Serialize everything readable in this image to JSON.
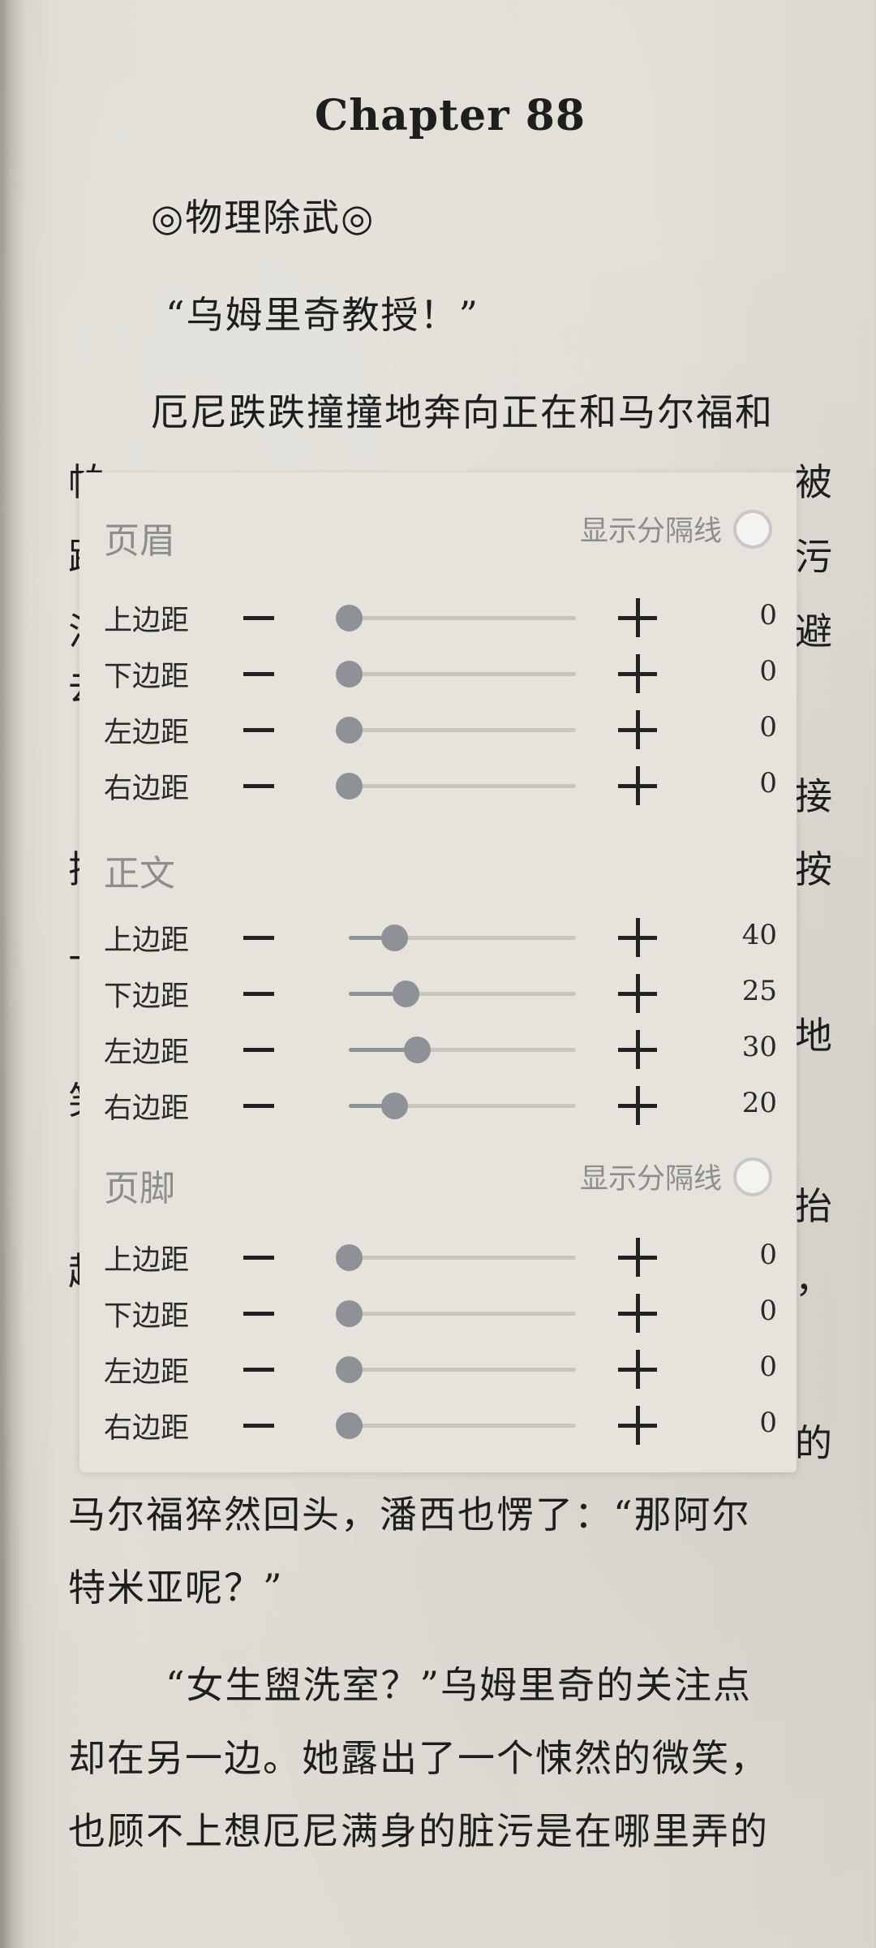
{
  "book": {
    "chapter_title": "Chapter 88",
    "lines": [
      "◎物理除武◎",
      "“乌姆里奇教授！”",
      "厄尼跌跌撞撞地奔向正在和马尔福和",
      "马尔福猝然回头，潘西也愣了：“那阿尔",
      "特米亚呢？”",
      "“女生盥洗室？”乌姆里奇的关注点",
      "却在另一边。她露出了一个悚然的微笑，",
      "也顾不上想厄尼满身的脏污是在哪里弄的"
    ],
    "right_edge_chars": [
      "被",
      "污",
      "避",
      "接",
      "按",
      "地",
      "抬",
      "，",
      "的"
    ],
    "left_edge_chars": [
      "帕",
      "跑",
      "沾",
      "去",
      "把",
      "上",
      "笑",
      "起"
    ]
  },
  "panel": {
    "header": {
      "title": "页眉",
      "divider_label": "显示分隔线",
      "rows": [
        {
          "label": "上边距",
          "value": "0",
          "level": 0
        },
        {
          "label": "下边距",
          "value": "0",
          "level": 0
        },
        {
          "label": "左边距",
          "value": "0",
          "level": 0
        },
        {
          "label": "右边距",
          "value": "0",
          "level": 0
        }
      ]
    },
    "body": {
      "title": "正文",
      "rows": [
        {
          "label": "上边距",
          "value": "40",
          "level": 0.2
        },
        {
          "label": "下边距",
          "value": "25",
          "level": 0.25
        },
        {
          "label": "左边距",
          "value": "30",
          "level": 0.3
        },
        {
          "label": "右边距",
          "value": "20",
          "level": 0.2
        }
      ]
    },
    "footer": {
      "title": "页脚",
      "divider_label": "显示分隔线",
      "rows": [
        {
          "label": "上边距",
          "value": "0",
          "level": 0
        },
        {
          "label": "下边距",
          "value": "0",
          "level": 0
        },
        {
          "label": "左边距",
          "value": "0",
          "level": 0
        },
        {
          "label": "右边距",
          "value": "0",
          "level": 0
        }
      ]
    }
  }
}
